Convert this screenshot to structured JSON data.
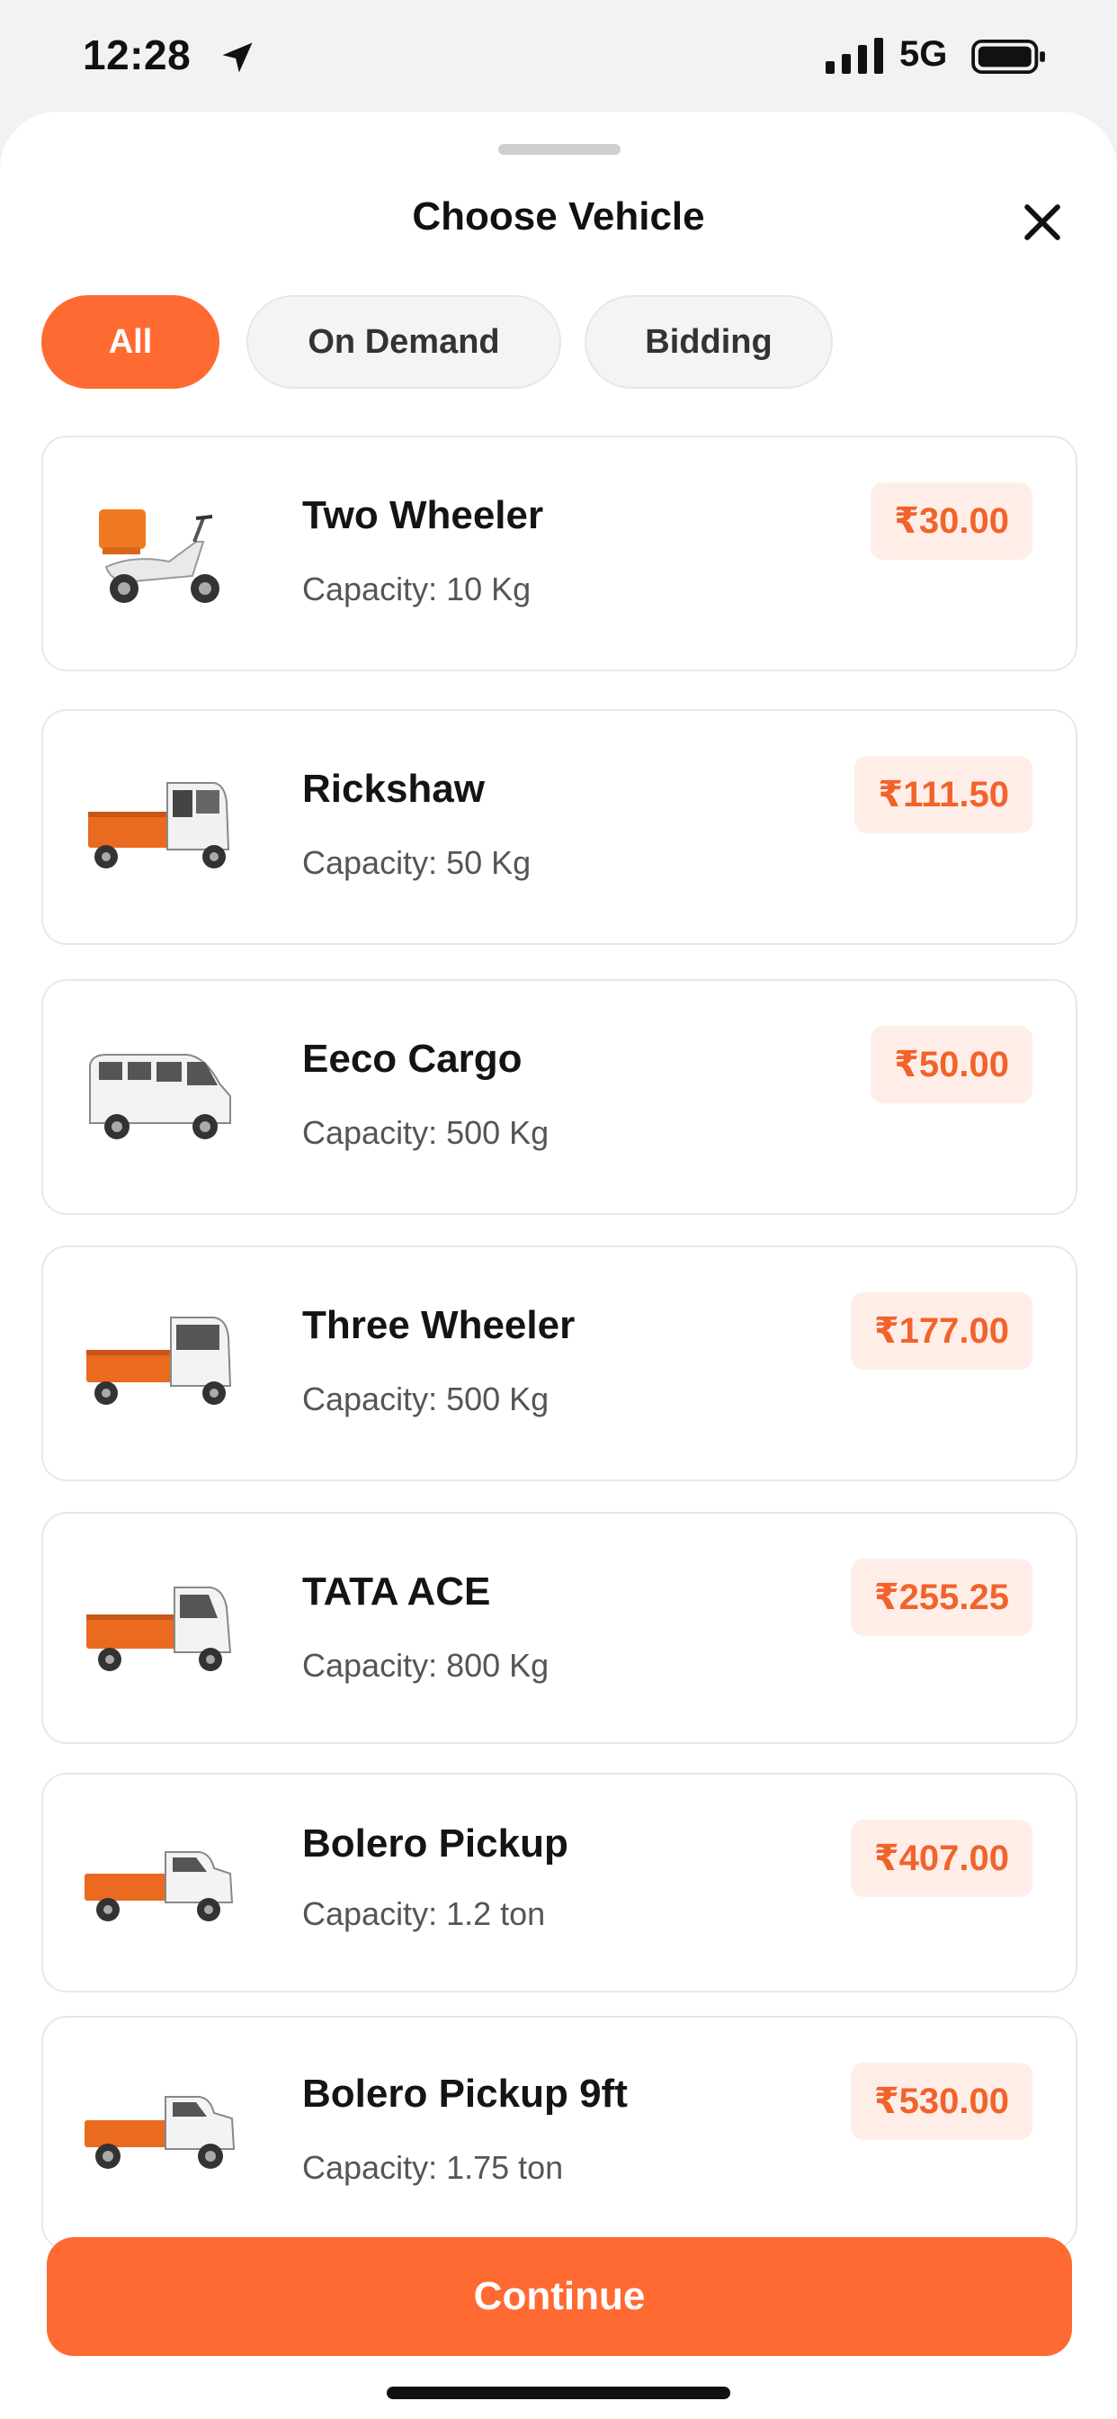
{
  "status_bar": {
    "time": "12:28",
    "network": "5G",
    "icons": [
      "location-arrow-icon",
      "signal-bars-icon",
      "battery-icon"
    ]
  },
  "sheet": {
    "title": "Choose Vehicle",
    "close_icon": "close-icon"
  },
  "filters": [
    {
      "label": "All",
      "active": true
    },
    {
      "label": "On Demand",
      "active": false
    },
    {
      "label": "Bidding",
      "active": false
    }
  ],
  "vehicles": [
    {
      "name": "Two Wheeler",
      "capacity": "Capacity: 10 Kg",
      "price": "₹30.00",
      "icon": "scooter-icon"
    },
    {
      "name": "Rickshaw",
      "capacity": "Capacity: 50 Kg",
      "price": "₹111.50",
      "icon": "rickshaw-icon"
    },
    {
      "name": "Eeco Cargo",
      "capacity": "Capacity: 500 Kg",
      "price": "₹50.00",
      "icon": "van-icon"
    },
    {
      "name": "Three Wheeler",
      "capacity": "Capacity: 500 Kg",
      "price": "₹177.00",
      "icon": "three-wheeler-icon"
    },
    {
      "name": "TATA ACE",
      "capacity": "Capacity: 800 Kg",
      "price": "₹255.25",
      "icon": "mini-truck-icon"
    },
    {
      "name": "Bolero Pickup",
      "capacity": "Capacity: 1.2 ton",
      "price": "₹407.00",
      "icon": "pickup-truck-icon"
    },
    {
      "name": "Bolero Pickup 9ft",
      "capacity": "Capacity: 1.75 ton",
      "price": "₹530.00",
      "icon": "pickup-truck-icon"
    }
  ],
  "actions": {
    "continue_label": "Continue"
  },
  "colors": {
    "accent": "#ff6a33",
    "price_bg": "#ffeee8",
    "price_text": "#f2632c"
  }
}
